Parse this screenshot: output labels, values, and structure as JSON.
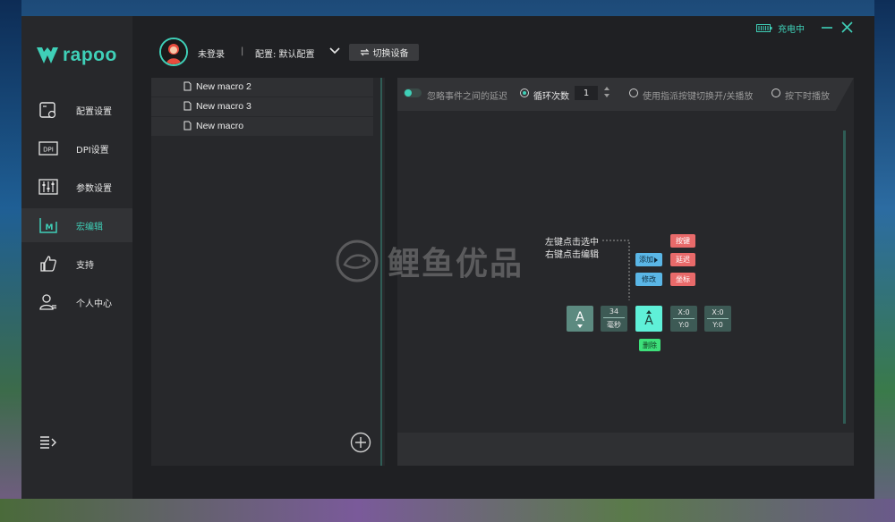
{
  "app": {
    "logo_text": "rapoo"
  },
  "status": {
    "charging_label": "充电中"
  },
  "user": {
    "login_label": "未登录",
    "separator": "|",
    "config_label": "配置: 默认配置",
    "switch_device_label": "切换设备"
  },
  "sidebar": {
    "items": [
      {
        "label": "配置设置",
        "icon": "config-icon"
      },
      {
        "label": "DPI设置",
        "icon": "dpi-icon"
      },
      {
        "label": "参数设置",
        "icon": "sliders-icon"
      },
      {
        "label": "宏编辑",
        "icon": "macro-icon",
        "active": true
      },
      {
        "label": "支持",
        "icon": "thumbs-up-icon"
      },
      {
        "label": "个人中心",
        "icon": "user-icon"
      }
    ]
  },
  "macros": [
    {
      "name": "New macro 2"
    },
    {
      "name": "New macro 3"
    },
    {
      "name": "New macro"
    }
  ],
  "toolbar": {
    "ignore_delay_label": "忽略事件之间的延迟",
    "loop_label": "循环次数",
    "loop_count": "1",
    "toggle_play_label": "使用指派按键切换开/关播放",
    "hold_play_label": "按下时播放"
  },
  "editor": {
    "tip_line1": "左键点击选中",
    "tip_line2": "右键点击编辑",
    "add_label": "添加",
    "modify_label": "修改",
    "key_label": "按键",
    "delay_label": "延迟",
    "coord_label": "坐标",
    "delete_label": "删除",
    "event_key": "A",
    "event_delay_value": "34",
    "event_delay_unit": "毫秒",
    "x_label": "X:0",
    "y_label": "Y:0"
  },
  "watermark": {
    "text": "鲤鱼优品"
  },
  "colors": {
    "accent": "#3fd0b8",
    "add_chip": "#5ab6e6",
    "type_chip": "#e86a6a",
    "delete_chip": "#3de07a"
  }
}
